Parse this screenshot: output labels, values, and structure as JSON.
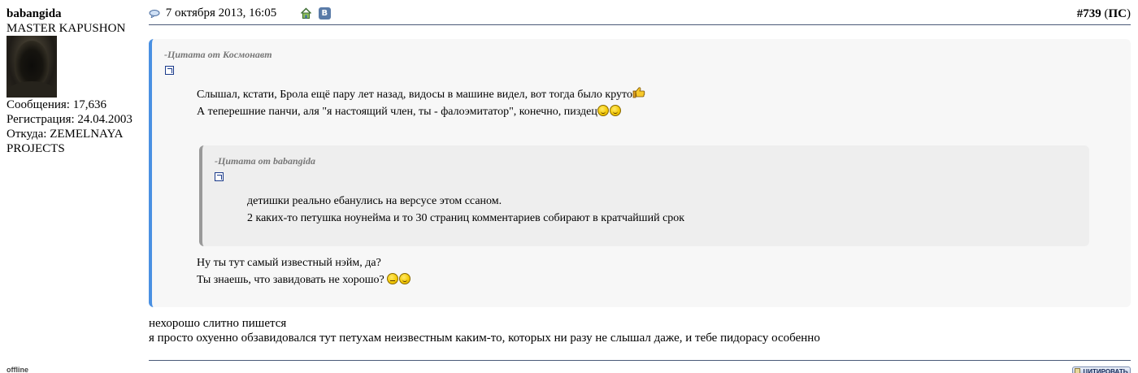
{
  "user": {
    "username": "babangida",
    "title": "MASTER KAPUSHON",
    "posts_label": "Сообщения: 17,636",
    "registered_label": "Регистрация: 24.04.2003",
    "location_line1": "Откуда: ZEMELNAYA",
    "location_line2": "PROJECTS",
    "status": "offline"
  },
  "header": {
    "date": "7 октября 2013, 16:05",
    "vk_label": "B",
    "post_number": "#739",
    "post_suffix_open": " (",
    "post_suffix": "ПС",
    "post_suffix_close": ")"
  },
  "outer_quote": {
    "author": "-Цитата от Космонавт",
    "lines_before": [
      "Слышал, кстати, Брола ещё пару лет назад, видосы в машине видел, вот тогда было круто",
      "А теперешние панчи, аля \"я настоящий член, ты - фалоэмитатор\", конечно, пиздец"
    ],
    "lines_after": [
      "Ну ты тут самый известный нэйм, да?",
      "Ты знаешь, что завидовать не хорошо?"
    ]
  },
  "inner_quote": {
    "author": "-Цитата от babangida",
    "lines": [
      "детишки реально ебанулись на версусе этом ссаном.",
      "2 каких-то петушка ноунейма и то 30 страниц комментариев собирают в кратчайший срок"
    ]
  },
  "body": {
    "lines": [
      "нехорошо слитно пишется",
      "я просто охуенно обзавидовался тут петухам неизвестным каким-то, которых ни разу не слышал даже, и тебе пидорасу особенно"
    ]
  },
  "footer": {
    "quote_button_label": "ЦИТИРОВАТЬ"
  },
  "colors": {
    "outer_quote_border": "#4a90e2",
    "outer_quote_bg": "#f7f7f7",
    "inner_quote_bg": "#eeeeee",
    "separator": "#4a5a78"
  }
}
